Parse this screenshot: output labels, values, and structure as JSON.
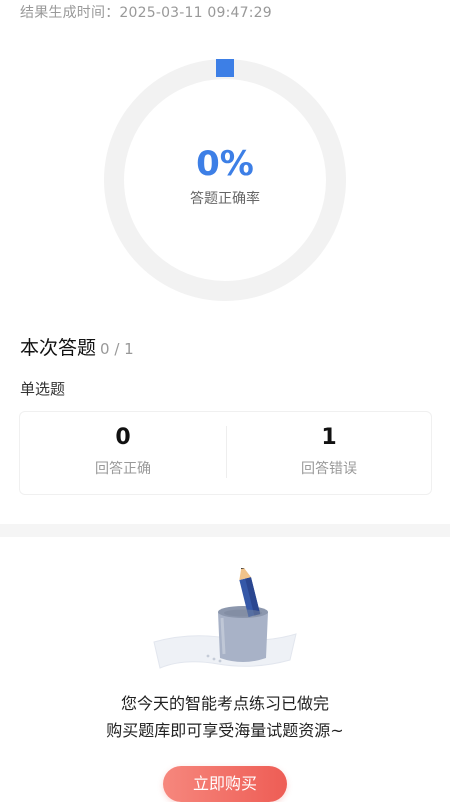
{
  "result": {
    "timestamp": "结果生成时间：2025-03-11 09:47:29"
  },
  "accuracy": {
    "percent_text": "0%",
    "value_percent": 0,
    "caption": "答题正确率"
  },
  "session": {
    "title": "本次答题",
    "count": "0 / 1"
  },
  "question_type": {
    "label": "单选题",
    "correct_count": "0",
    "correct_label": "回答正确",
    "wrong_count": "1",
    "wrong_label": "回答错误"
  },
  "empty_state": {
    "illustration_icon": "pencil-cup-icon",
    "line1": "您今天的智能考点练习已做完",
    "line2": "购买题库即可享受海量试题资源~"
  },
  "cta": {
    "buy_label": "立即购买"
  },
  "colors": {
    "accent": "#3d7fe6",
    "ring_track": "#f2f2f2",
    "button_start": "#f6877d",
    "button_end": "#ee5d55"
  }
}
